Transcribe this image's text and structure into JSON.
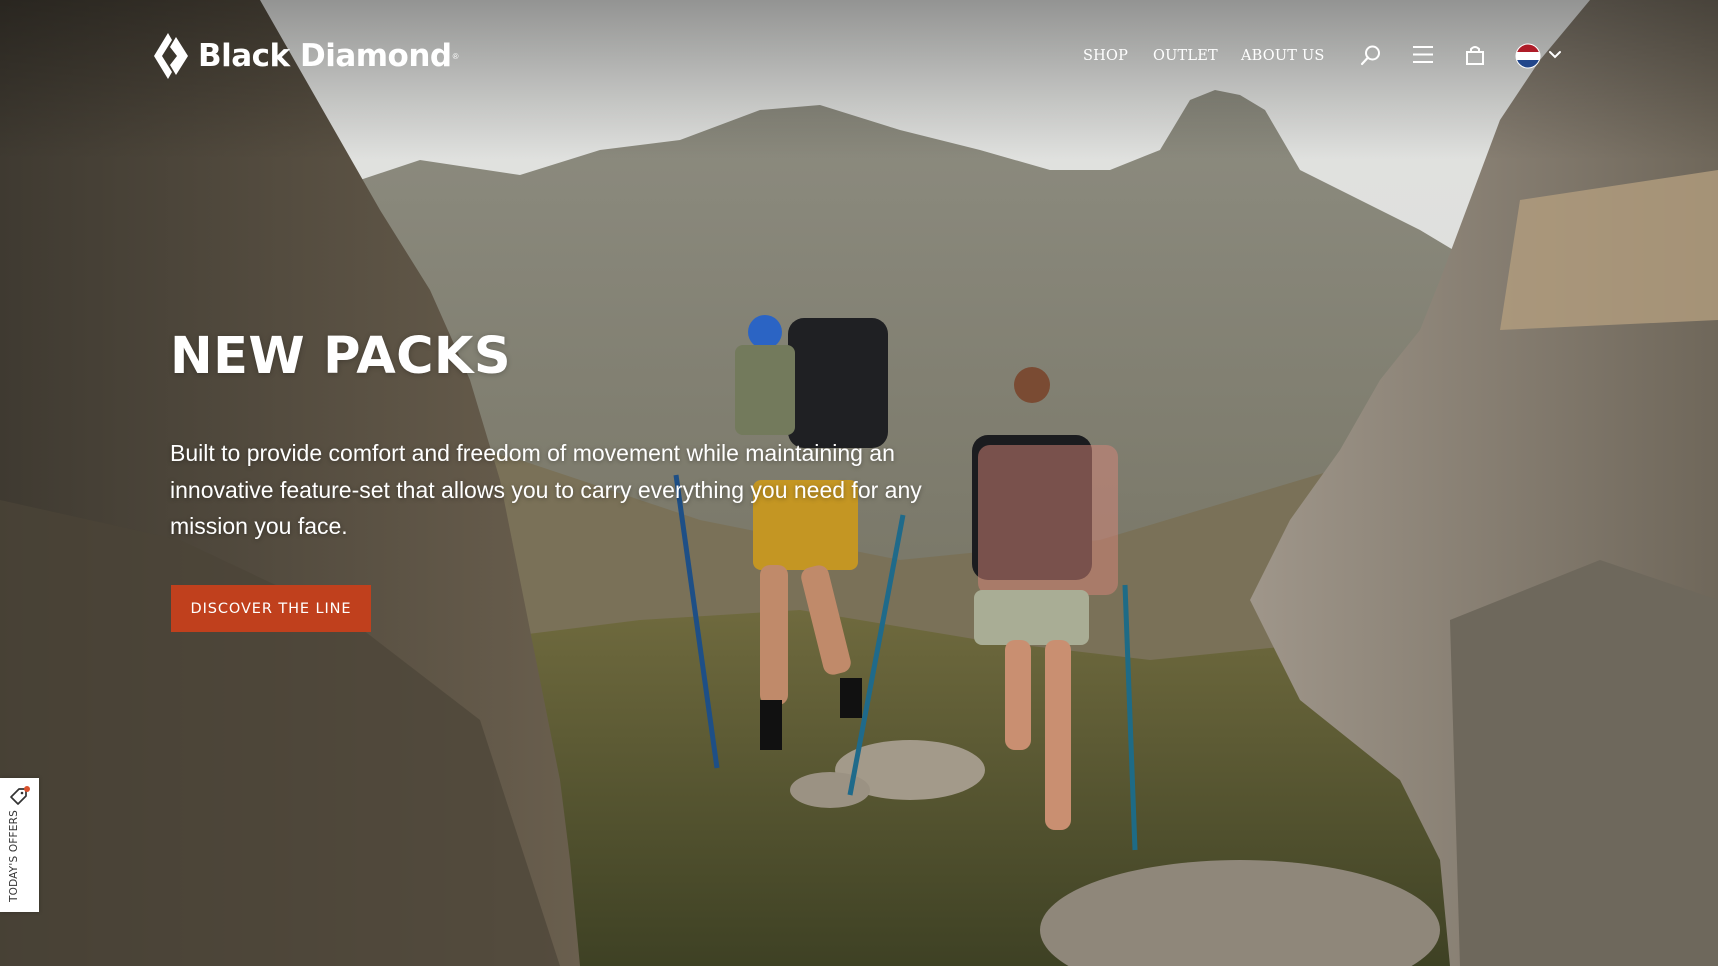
{
  "header": {
    "logo_text": "Black Diamond",
    "logo_trademark": "®",
    "nav": [
      {
        "label": "SHOP"
      },
      {
        "label": "OUTLET"
      },
      {
        "label": "ABOUT US"
      }
    ],
    "icons": {
      "search": "search-icon",
      "menu": "hamburger-menu-icon",
      "cart": "shopping-bag-icon",
      "region": "netherlands-flag-icon",
      "region_toggle": "chevron-down-icon"
    }
  },
  "hero": {
    "title": "NEW PACKS",
    "description": "Built to provide comfort and freedom of movement while maintaining an innovative feature-set that allows you to carry everything you need for any mission you face.",
    "cta_label": "DISCOVER THE LINE"
  },
  "offers_tab": {
    "label": "TODAY'S OFFERS",
    "icon": "tag-icon"
  },
  "colors": {
    "accent": "#c0401d",
    "text": "#ffffff",
    "flag_red": "#ae1c28",
    "flag_blue": "#21468b"
  }
}
